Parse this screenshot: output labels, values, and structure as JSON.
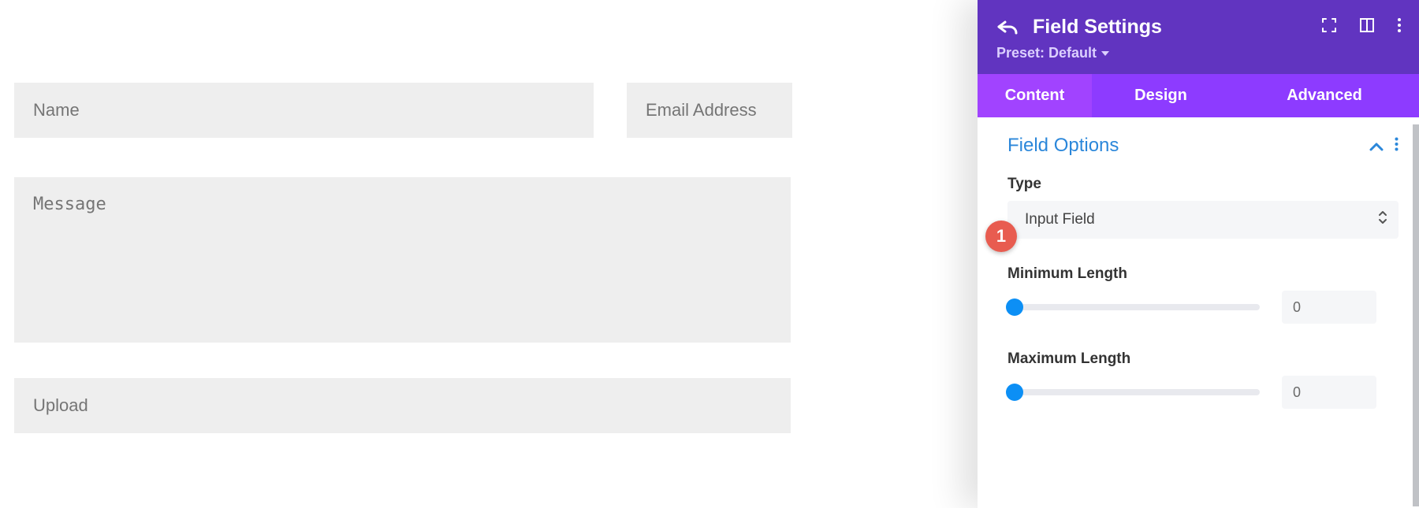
{
  "form": {
    "fields": {
      "name_placeholder": "Name",
      "email_placeholder": "Email Address",
      "message_placeholder": "Message",
      "upload_placeholder": "Upload"
    }
  },
  "panel": {
    "title": "Field Settings",
    "preset_label": "Preset: Default",
    "tabs": {
      "content": "Content",
      "design": "Design",
      "advanced": "Advanced"
    },
    "section_title": "Field Options",
    "type": {
      "label": "Type",
      "value": "Input Field"
    },
    "min_length": {
      "label": "Minimum Length",
      "value": "0"
    },
    "max_length": {
      "label": "Maximum Length",
      "value": "0"
    }
  },
  "annotation": {
    "step1": "1"
  }
}
